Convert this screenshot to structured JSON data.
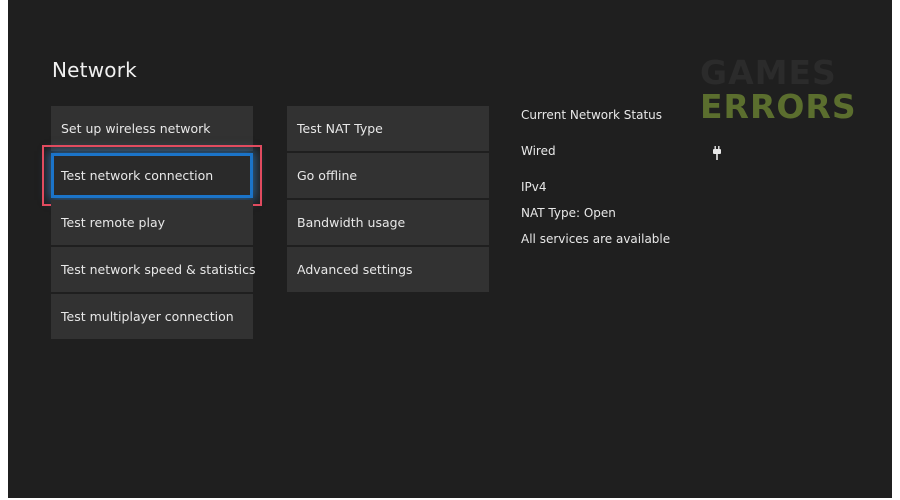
{
  "page": {
    "title": "Network"
  },
  "menu_left": {
    "items": [
      {
        "label": "Set up wireless network",
        "focused": false
      },
      {
        "label": "Test network connection",
        "focused": true
      },
      {
        "label": "Test remote play",
        "focused": false
      },
      {
        "label": "Test network speed & statistics",
        "focused": false
      },
      {
        "label": "Test multiplayer connection",
        "focused": false
      }
    ]
  },
  "menu_mid": {
    "items": [
      {
        "label": "Test NAT Type"
      },
      {
        "label": "Go offline"
      },
      {
        "label": "Bandwidth usage"
      },
      {
        "label": "Advanced settings"
      }
    ]
  },
  "status": {
    "heading": "Current Network Status",
    "connection": "Wired",
    "connection_icon": "plug-icon",
    "protocol": "IPv4",
    "nat": "NAT Type: Open",
    "services": "All services are available"
  },
  "watermark": {
    "line1": "GAMES",
    "line2": "ERRORS"
  },
  "colors": {
    "background": "#1f1f1f",
    "tile": "#323232",
    "focus_border": "#1b74c9",
    "highlight_box": "#e04b5f",
    "watermark_green": "#5b6e2e"
  }
}
